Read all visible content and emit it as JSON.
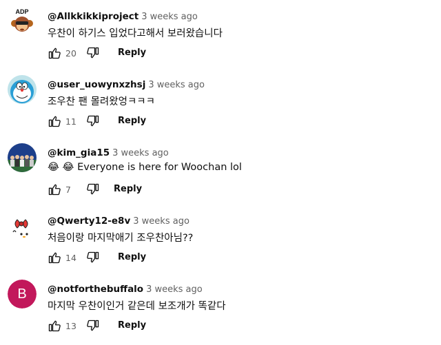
{
  "comments": [
    {
      "author": "@Allkkikkiproject",
      "time": "3 weeks ago",
      "text": "우찬이 하기스 입었다고해서 보러왔습니다",
      "likes": "20",
      "reply_label": "Reply",
      "avatar_icon": "monkey-logo-icon",
      "avatar_logo_text": "ADP"
    },
    {
      "author": "@user_uowynxzhsj",
      "time": "3 weeks ago",
      "text": "조우찬 팬 몰려왔엉ㅋㅋㅋ",
      "likes": "11",
      "reply_label": "Reply",
      "avatar_icon": "doraemon-icon"
    },
    {
      "author": "@kim_gia15",
      "time": "3 weeks ago",
      "text": "😂 😂 Everyone is here for Woochan lol",
      "likes": "7",
      "reply_label": "Reply",
      "avatar_icon": "group-photo-icon"
    },
    {
      "author": "@Qwerty12-e8v",
      "time": "3 weeks ago",
      "text": "처음이랑 마지막애기 조우찬아님??",
      "likes": "14",
      "reply_label": "Reply",
      "avatar_icon": "hello-kitty-icon"
    },
    {
      "author": "@notforthebuffalo",
      "time": "3 weeks ago",
      "text": "마지막 우찬이인거 같은데 보조개가 똑같다",
      "likes": "13",
      "reply_label": "Reply",
      "avatar_icon": "letter-avatar-icon",
      "avatar_letter": "B",
      "avatar_color": "#c2185b"
    }
  ],
  "colors": {
    "text": "#0f0f0f",
    "secondary": "#606060"
  }
}
